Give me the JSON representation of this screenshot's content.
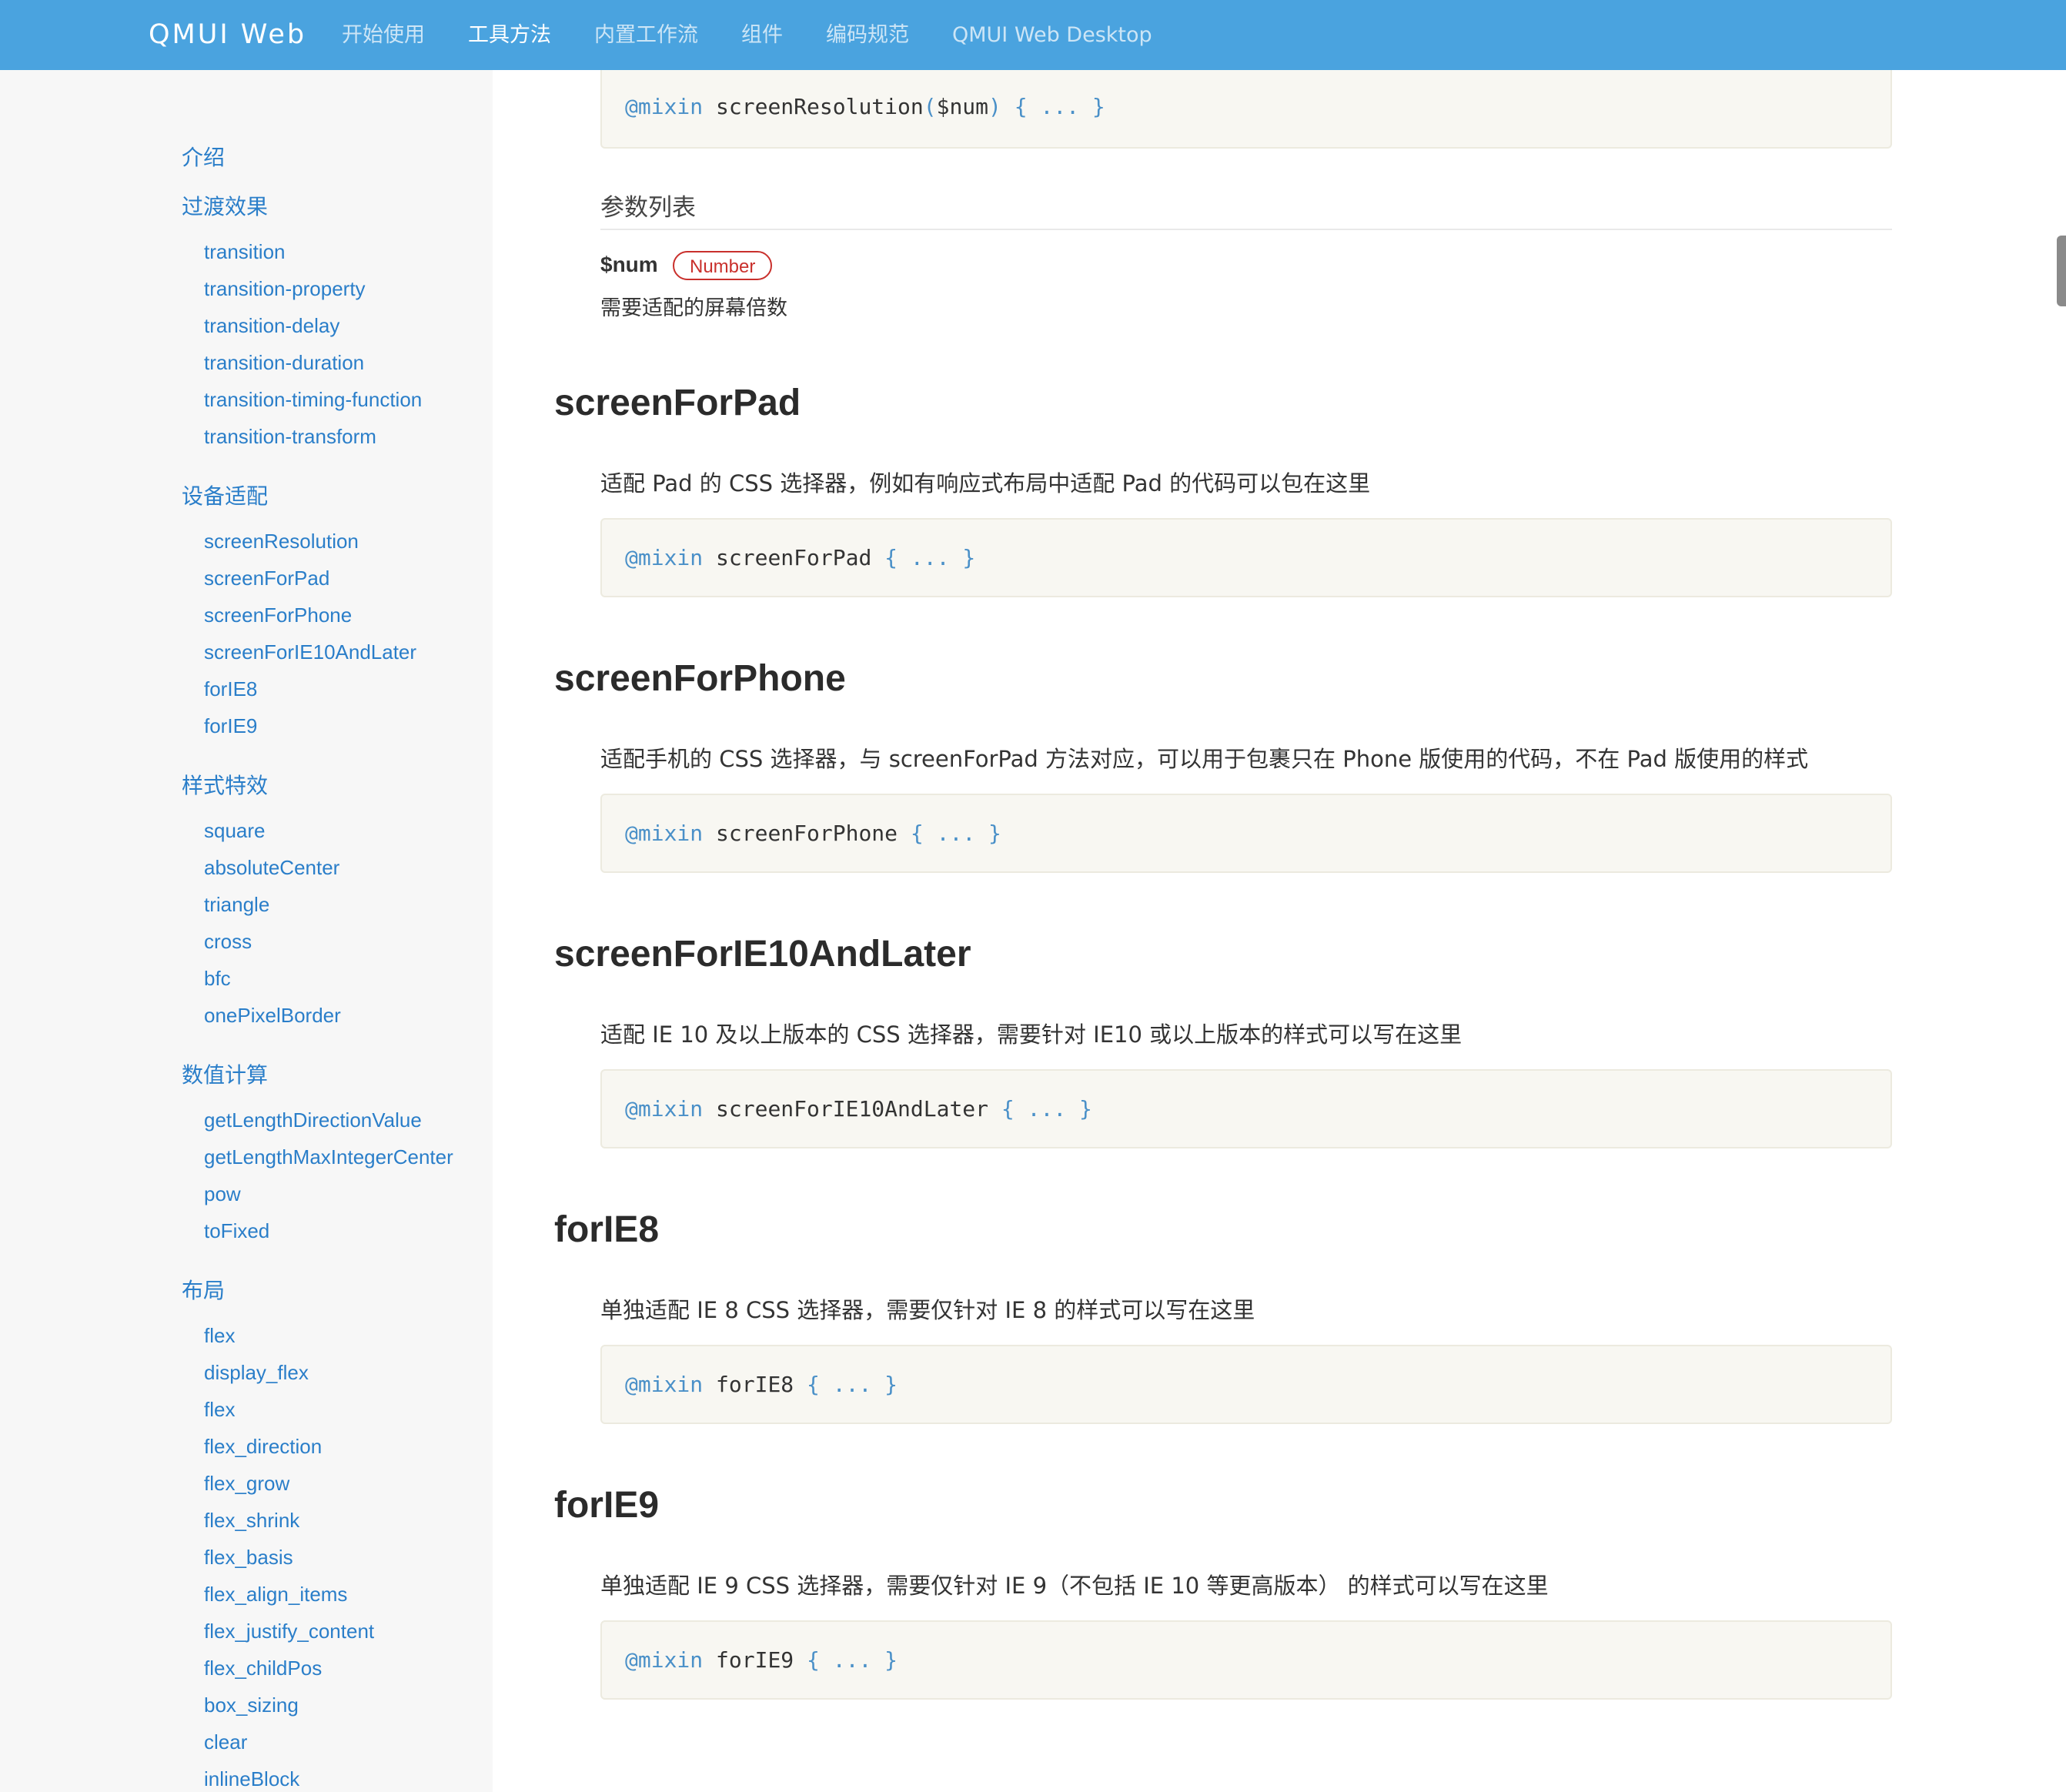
{
  "brand": "QMUI Web",
  "nav": [
    "开始使用",
    "工具方法",
    "内置工作流",
    "组件",
    "编码规范",
    "QMUI Web Desktop"
  ],
  "sidebar": {
    "intro": "介绍",
    "transition": {
      "title": "过渡效果",
      "items": [
        "transition",
        "transition-property",
        "transition-delay",
        "transition-duration",
        "transition-timing-function",
        "transition-transform"
      ]
    },
    "device": {
      "title": "设备适配",
      "items": [
        "screenResolution",
        "screenForPad",
        "screenForPhone",
        "screenForIE10AndLater",
        "forIE8",
        "forIE9"
      ]
    },
    "style": {
      "title": "样式特效",
      "items": [
        "square",
        "absoluteCenter",
        "triangle",
        "cross",
        "bfc",
        "onePixelBorder"
      ]
    },
    "calc": {
      "title": "数值计算",
      "items": [
        "getLengthDirectionValue",
        "getLengthMaxIntegerCenter",
        "pow",
        "toFixed"
      ]
    },
    "layout": {
      "title": "布局",
      "items": [
        "flex",
        "display_flex",
        "flex",
        "flex_direction",
        "flex_grow",
        "flex_shrink",
        "flex_basis",
        "flex_align_items",
        "flex_justify_content",
        "flex_childPos",
        "box_sizing",
        "clear",
        "inlineBlock"
      ]
    }
  },
  "content": {
    "top_code": {
      "kw": "@mixin",
      "name": "screenResolution",
      "open": "(",
      "arg": "$num",
      "close": ")",
      "body": " { ... }"
    },
    "params_title": "参数列表",
    "param_name": "$num",
    "param_type": "Number",
    "param_desc": "需要适配的屏幕倍数",
    "sections": [
      {
        "title": "screenForPad",
        "desc": "适配 Pad 的 CSS 选择器，例如有响应式布局中适配 Pad 的代码可以包在这里",
        "kw": "@mixin",
        "name": "screenForPad",
        "body": "{ ... }"
      },
      {
        "title": "screenForPhone",
        "desc": "适配手机的 CSS 选择器，与 screenForPad 方法对应，可以用于包裹只在 Phone 版使用的代码，不在 Pad 版使用的样式",
        "kw": "@mixin",
        "name": "screenForPhone",
        "body": "{ ... }"
      },
      {
        "title": "screenForIE10AndLater",
        "desc": "适配 IE 10 及以上版本的 CSS 选择器，需要针对 IE10 或以上版本的样式可以写在这里",
        "kw": "@mixin",
        "name": "screenForIE10AndLater",
        "body": "{ ... }"
      },
      {
        "title": "forIE8",
        "desc": "单独适配 IE 8 CSS 选择器，需要仅针对 IE 8 的样式可以写在这里",
        "kw": "@mixin",
        "name": "forIE8",
        "body": "{ ... }"
      },
      {
        "title": "forIE9",
        "desc": "单独适配 IE 9 CSS 选择器，需要仅针对 IE 9（不包括 IE 10 等更高版本） 的样式可以写在这里",
        "kw": "@mixin",
        "name": "forIE9",
        "body": "{ ... }"
      }
    ]
  },
  "colors": {
    "nav_bg": "#4aa3df",
    "link": "#2a7ec9",
    "badge": "#c9302c",
    "code_bg": "#f8f7f2"
  }
}
